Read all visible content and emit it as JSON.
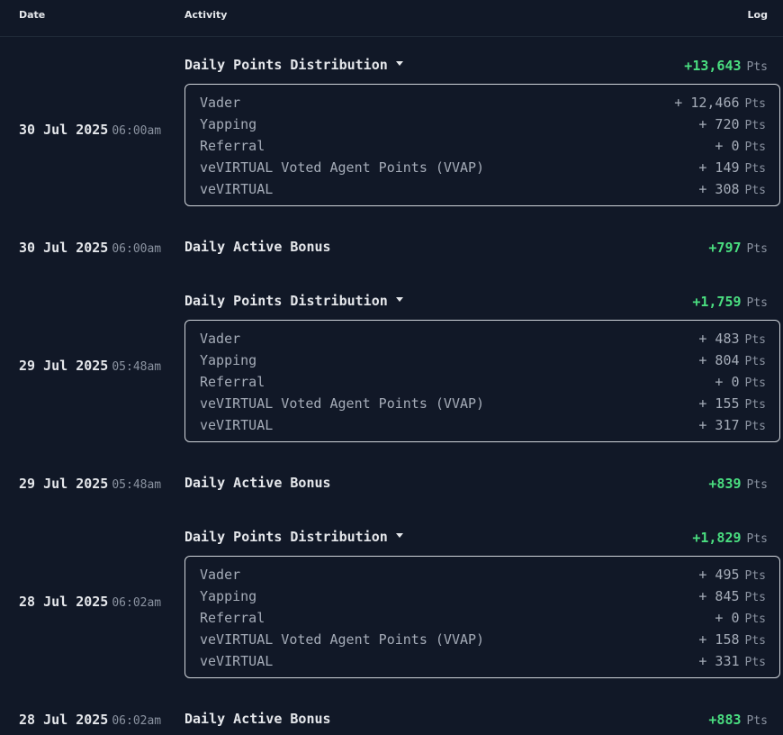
{
  "header": {
    "date": "Date",
    "activity": "Activity",
    "log": "Log"
  },
  "unit": "Pts",
  "entries": [
    {
      "date": "30 Jul 2025",
      "time": "06:00am",
      "title": "Daily Points Distribution",
      "total": "+13,643",
      "breakdown": [
        {
          "label": "Vader",
          "amount": "+ 12,466"
        },
        {
          "label": "Yapping",
          "amount": "+ 720"
        },
        {
          "label": "Referral",
          "amount": "+ 0"
        },
        {
          "label": "veVIRTUAL Voted Agent Points (VVAP)",
          "amount": "+ 149"
        },
        {
          "label": "veVIRTUAL",
          "amount": "+ 308"
        }
      ]
    },
    {
      "date": "30 Jul 2025",
      "time": "06:00am",
      "title": "Daily Active Bonus",
      "total": "+797"
    },
    {
      "date": "29 Jul 2025",
      "time": "05:48am",
      "title": "Daily Points Distribution",
      "total": "+1,759",
      "breakdown": [
        {
          "label": "Vader",
          "amount": "+ 483"
        },
        {
          "label": "Yapping",
          "amount": "+ 804"
        },
        {
          "label": "Referral",
          "amount": "+ 0"
        },
        {
          "label": "veVIRTUAL Voted Agent Points (VVAP)",
          "amount": "+ 155"
        },
        {
          "label": "veVIRTUAL",
          "amount": "+ 317"
        }
      ]
    },
    {
      "date": "29 Jul 2025",
      "time": "05:48am",
      "title": "Daily Active Bonus",
      "total": "+839"
    },
    {
      "date": "28 Jul 2025",
      "time": "06:02am",
      "title": "Daily Points Distribution",
      "total": "+1,829",
      "breakdown": [
        {
          "label": "Vader",
          "amount": "+ 495"
        },
        {
          "label": "Yapping",
          "amount": "+ 845"
        },
        {
          "label": "Referral",
          "amount": "+ 0"
        },
        {
          "label": "veVIRTUAL Voted Agent Points (VVAP)",
          "amount": "+ 158"
        },
        {
          "label": "veVIRTUAL",
          "amount": "+ 331"
        }
      ]
    },
    {
      "date": "28 Jul 2025",
      "time": "06:02am",
      "title": "Daily Active Bonus",
      "total": "+883"
    }
  ],
  "colors": {
    "background": "#111827",
    "positive": "#4ade80",
    "muted": "#8b93a1",
    "box_border": "#d1d5db"
  }
}
